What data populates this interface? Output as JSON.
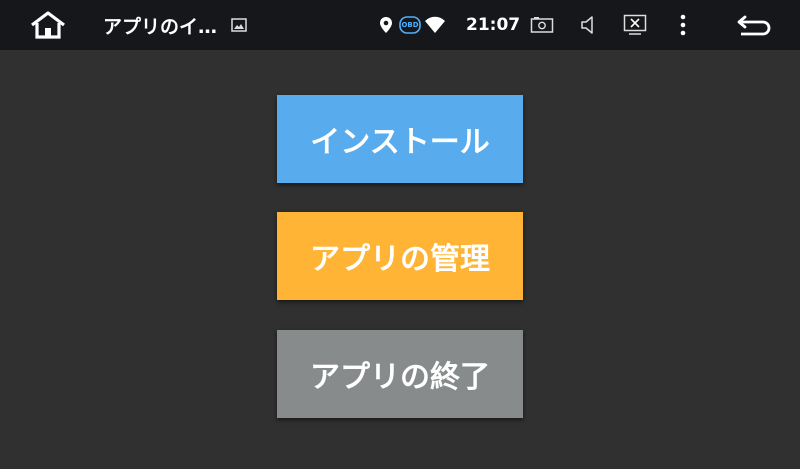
{
  "statusbar": {
    "title": "アプリのイ…",
    "time": "21:07",
    "obd_label": "OBD",
    "icons": {
      "home": "home-icon",
      "image": "image-icon",
      "location": "location-pin-icon",
      "obd": "obd-icon",
      "wifi": "wifi-icon",
      "camera": "camera-icon",
      "volume": "volume-icon",
      "close_screen": "screen-close-icon",
      "menu": "more-vert-icon",
      "back": "back-icon"
    }
  },
  "buttons": {
    "install": "インストール",
    "manage": "アプリの管理",
    "exit": "アプリの終了"
  },
  "colors": {
    "statusbar_bg": "#15171b",
    "content_bg": "#303030",
    "install": "#58aced",
    "manage": "#ffb435",
    "exit": "#888b8c"
  }
}
